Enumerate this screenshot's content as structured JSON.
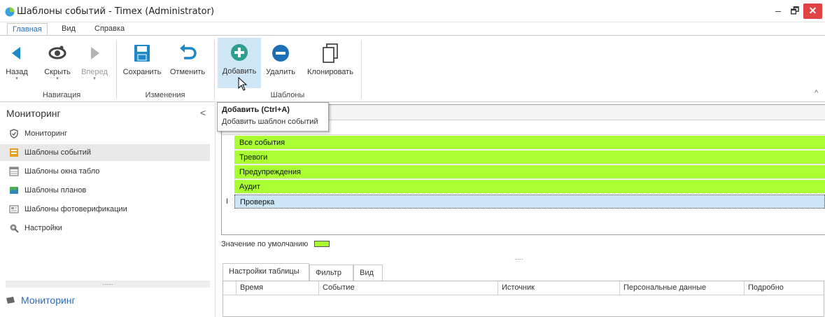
{
  "window": {
    "title": "Шаблоны событий - Timex (Administrator)",
    "minimize": "–",
    "restore": "🗗",
    "close": "✕"
  },
  "menu": {
    "tabs": [
      {
        "label": "Главная",
        "active": true
      },
      {
        "label": "Вид",
        "active": false
      },
      {
        "label": "Справка",
        "active": false
      }
    ]
  },
  "ribbon": {
    "buttons": [
      {
        "label": "Назад",
        "icon": "back-arrow-icon",
        "caret": "▾"
      },
      {
        "label": "Скрыть",
        "icon": "eye-hide-icon",
        "caret": "▾"
      },
      {
        "label": "Вперед",
        "icon": "forward-arrow-icon",
        "caret": "▾",
        "disabled": true
      },
      {
        "label": "Сохранить",
        "icon": "save-icon"
      },
      {
        "label": "Отменить",
        "icon": "undo-icon"
      },
      {
        "label": "Добавить",
        "icon": "add-icon",
        "hover": true
      },
      {
        "label": "Удалить",
        "icon": "remove-icon"
      },
      {
        "label": "Клонировать",
        "icon": "clone-icon"
      }
    ],
    "groups": [
      "Навигация",
      "Изменения",
      "Шаблоны"
    ],
    "collapse": "^",
    "accent": "#1e88c8"
  },
  "left_panel": {
    "header": "Мониторинг",
    "collapse": "<",
    "items": [
      {
        "label": "Мониторинг",
        "icon": "shield-check-icon",
        "selected": false
      },
      {
        "label": "Шаблоны событий",
        "icon": "event-templates-icon",
        "selected": true
      },
      {
        "label": "Шаблоны окна табло",
        "icon": "board-templates-icon",
        "selected": false
      },
      {
        "label": "Шаблоны планов",
        "icon": "map-templates-icon",
        "selected": false
      },
      {
        "label": "Шаблоны фотоверификации",
        "icon": "photo-verification-icon",
        "selected": false
      },
      {
        "label": "Настройки",
        "icon": "settings-icon",
        "selected": false
      }
    ],
    "splitter": "......",
    "bottom_label": "Мониторинг"
  },
  "tooltip": {
    "title": "Добавить (Ctrl+A)",
    "description": "Добавить шаблон событий"
  },
  "templates": {
    "rows": [
      {
        "label": "Все события",
        "color": "#aaff33"
      },
      {
        "label": "Тревоги",
        "color": "#aaff33"
      },
      {
        "label": "Предупреждения",
        "color": "#aaff33"
      },
      {
        "label": "Аудит",
        "color": "#aaff33"
      },
      {
        "label": "Проверка",
        "selected": true
      }
    ],
    "edit_indicator": "I"
  },
  "default_value": {
    "label": "Значение по умолчанию",
    "color": "#aaff33"
  },
  "splitter": ".....",
  "bottom_tabs": [
    {
      "label": "Настройки таблицы",
      "active": true
    },
    {
      "label": "Фильтр",
      "active": false
    },
    {
      "label": "Вид",
      "active": false
    }
  ],
  "table": {
    "columns": [
      "Время",
      "Событие",
      "Источник",
      "Персональные данные",
      "Подробно"
    ]
  }
}
